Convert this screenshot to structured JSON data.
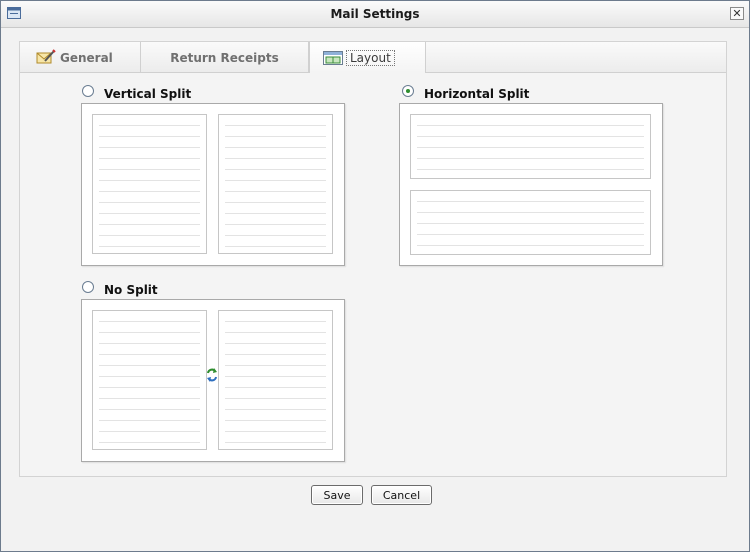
{
  "window": {
    "title": "Mail Settings",
    "close_glyph": "✕"
  },
  "tabs": [
    {
      "label": "General",
      "icon": "pencil-icon",
      "active": false
    },
    {
      "label": "Return Receipts",
      "active": false
    },
    {
      "label": "Layout",
      "icon": "layout-icon",
      "active": true
    }
  ],
  "layout_options": {
    "vertical": {
      "label": "Vertical Split",
      "selected": false
    },
    "horizontal": {
      "label": "Horizontal Split",
      "selected": true
    },
    "nosplit": {
      "label": "No Split",
      "selected": false
    }
  },
  "buttons": {
    "save_label": "Save",
    "cancel_label": "Cancel"
  },
  "colors": {
    "accent": "#2f8d2f",
    "border": "#6d7b8d"
  }
}
